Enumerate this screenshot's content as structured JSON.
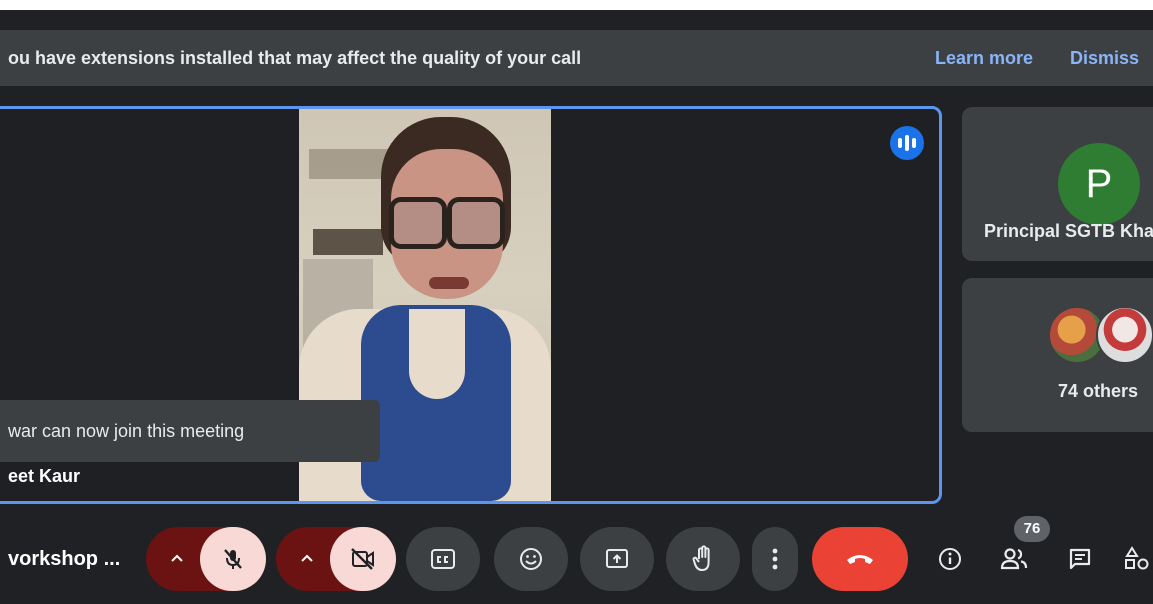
{
  "banner": {
    "message": "ou have extensions installed that may affect the quality of your call",
    "learn_more": "Learn more",
    "dismiss": "Dismiss"
  },
  "main": {
    "toast": "war can now join this meeting",
    "speaker_name": "eet Kaur"
  },
  "side": {
    "principal_initial": "P",
    "principal_name": "Principal SGTB Kha",
    "others": "74 others"
  },
  "bottom": {
    "meeting_title": "vorkshop ...",
    "participant_count": "76"
  },
  "colors": {
    "background": "#202124",
    "accent": "#8ab4f8",
    "active_border": "#5b95f0",
    "end_call": "#ea4335",
    "muted_control": "#f8d9d6"
  }
}
